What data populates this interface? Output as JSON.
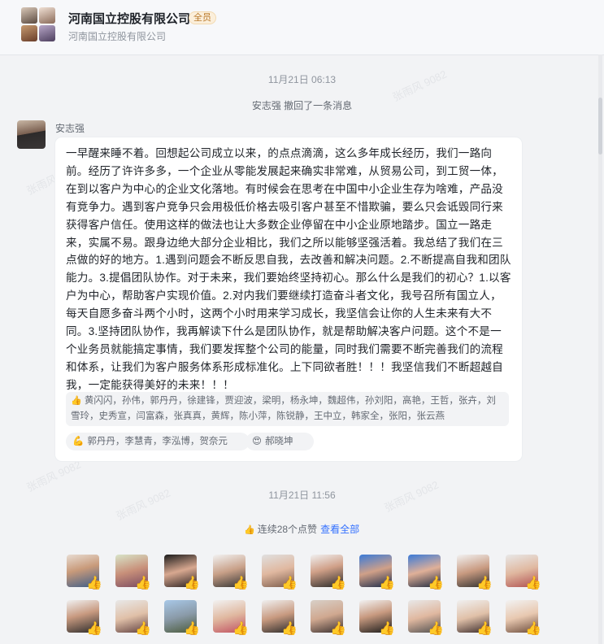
{
  "header": {
    "org_name": "河南国立控股有限公司",
    "badge": "全员",
    "subtitle": "河南国立控股有限公司"
  },
  "timeline": {
    "time1": "11月21日 06:13",
    "recall_notice": "安志强  撤回了一条消息",
    "time2": "11月21日 11:56"
  },
  "message": {
    "sender": "安志强",
    "text": "一早醒来睡不着。回想起公司成立以来，的点点滴滴，这么多年成长经历，我们一路向前。经历了许许多多，一个企业从零能发展起来确实非常难，从贸易公司，到工贸一体，在到以客户为中心的企业文化落地。有时候会在思考在中国中小企业生存为啥难，产品没有竞争力。遇到客户竞争只会用极低价格去吸引客户甚至不惜欺骗，要么只会诋毁同行来获得客户信任。使用这样的做法也让大多数企业停留在中小企业原地踏步。国立一路走来，实属不易。跟身边绝大部分企业相比，我们之所以能够坚强活着。我总结了我们在三点做的好的地方。1.遇到问题会不断反思自我，去改善和解决问题。2.不断提高自我和团队能力。3.提倡团队协作。对于未来，我们要始终坚持初心。那么什么是我们的初心？1.以客户为中心，帮助客户实现价值。2.对内我们要继续打造奋斗者文化，我号召所有国立人，每天自愿多奋斗两个小时，这两个小时用来学习成长，我坚信会让你的人生未来有大不同。3.坚持团队协作，我再解读下什么是团队协作，就是帮助解决客户问题。这个不是一个业务员就能搞定事情，我们要发挥整个公司的能量，同时我们需要不断完善我们的流程和体系，让我们为客户服务体系形成标准化。上下同欲者胜！！！我坚信我们不断超越自我，一定能获得美好的未来！！！",
    "like_names": "黄闪闪，孙伟，郭丹丹，徐建锋，贾迎波，梁明，杨永坤，魏超伟，孙刘阳，高艳，王哲，张卉，刘雪玲，史秀宣，闫富森，张真真，黄辉，陈小萍，陈锐静，王中立，韩家全，张阳，张云燕",
    "reaction1_names": "郭丹丹，李慧青，李泓博，贺奈元",
    "reaction2_names": "郝晓坤"
  },
  "likes_summary": {
    "text": "连续28个点赞",
    "view_all": "查看全部"
  },
  "watermark": "张雨风 9082",
  "colors": {
    "link": "#3370ff",
    "badge_text": "#b9792a",
    "bubble_bg": "#ffffff",
    "page_bg": "#f2f3f5"
  }
}
